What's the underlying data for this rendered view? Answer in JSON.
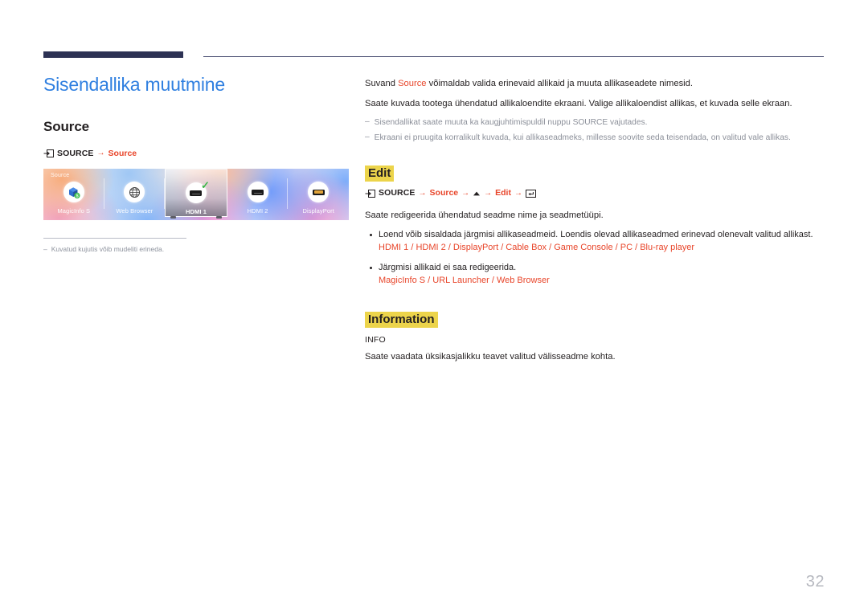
{
  "header": {
    "rule_color": "#2d3254",
    "thin_rule_color": "#4a4f73"
  },
  "page_title": "Sisendallika muutmine",
  "left": {
    "section_title": "Source",
    "breadcrumb": {
      "source_key": "SOURCE",
      "arrow": "→",
      "target": "Source"
    },
    "mock": {
      "title": "Source",
      "items": [
        {
          "label": "MagicInfo S",
          "icon": "magicinfo-icon",
          "selected": false
        },
        {
          "label": "Web Browser",
          "icon": "globe-icon",
          "selected": false
        },
        {
          "label": "HDMI 1",
          "icon": "hdmi-port-icon",
          "selected": true
        },
        {
          "label": "HDMI 2",
          "icon": "hdmi-port-icon",
          "selected": false
        },
        {
          "label": "DisplayPort",
          "icon": "displayport-port-icon",
          "selected": false
        }
      ]
    },
    "footnote": {
      "dash": "–",
      "text": "Kuvatud kujutis võib mudeliti erineda."
    }
  },
  "right": {
    "intro": {
      "p1_before": "Suvand ",
      "p1_accent": "Source",
      "p1_after": " võimaldab valida erinevaid allikaid ja muuta allikaseadete nimesid.",
      "p2": "Saate kuvada tootega ühendatud allikaloendite ekraani. Valige allikaloendist allikas, et kuvada selle ekraan.",
      "notes": [
        "Sisendallikat saate muuta ka kaugjuhtimispuldil nuppu SOURCE vajutades.",
        "Ekraani ei pruugita korralikult kuvada, kui allikaseadmeks, millesse soovite seda teisendada, on valitud vale allikas."
      ],
      "note_dash": "–"
    },
    "edit": {
      "heading": "Edit",
      "breadcrumb": {
        "source_key": "SOURCE",
        "arrow": "→",
        "step1": "Source",
        "step2_icon": "up-arrow-icon",
        "step3": "Edit",
        "step4_icon": "enter-key-icon"
      },
      "lead": "Saate redigeerida ühendatud seadme nime ja seadmetüüpi.",
      "bullets": [
        {
          "text": "Loend võib sisaldada järgmisi allikaseadmeid. Loendis olevad allikaseadmed erinevad olenevalt valitud allikast.",
          "sources": "HDMI 1 / HDMI 2 / DisplayPort / Cable Box / Game Console / PC / Blu-ray player"
        },
        {
          "text": "Järgmisi allikaid ei saa redigeerida.",
          "sources": "MagicInfo S / URL Launcher / Web Browser"
        }
      ]
    },
    "information": {
      "heading": "Information",
      "sub_label": "INFO",
      "body": "Saate vaadata üksikasjalikku teavet valitud välisseadme kohta."
    }
  },
  "page_number": "32",
  "colors": {
    "title_blue": "#2f7fe0",
    "accent_red": "#e8452a",
    "highlight_yellow": "#ecd44b",
    "note_gray": "#8b8f99",
    "page_number_gray": "#b6b8bf"
  }
}
